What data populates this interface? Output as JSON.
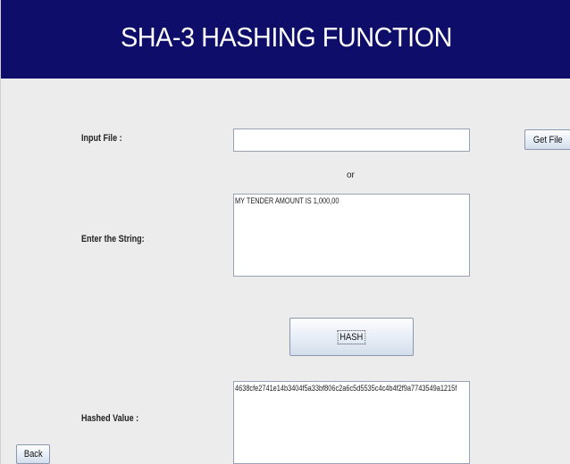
{
  "header": {
    "title": "SHA-3 HASHING FUNCTION"
  },
  "form": {
    "input_file_label": "Input File :",
    "input_file_value": "",
    "get_file_label": "Get File",
    "or_label": "or",
    "string_label": "Enter the String:",
    "string_value": "MY TENDER AMOUNT IS 1,000,00",
    "hash_label": "HASH",
    "hashed_label": "Hashed Value :",
    "hashed_value": "4638cfe2741e14b3404f5a33bf806c2a6c5d5535c4c4b4f2f9a7743549a1215f"
  },
  "footer": {
    "back_label": "Back"
  },
  "colors": {
    "header_bg": "#0e0e6a",
    "window_bg": "#ececec"
  }
}
